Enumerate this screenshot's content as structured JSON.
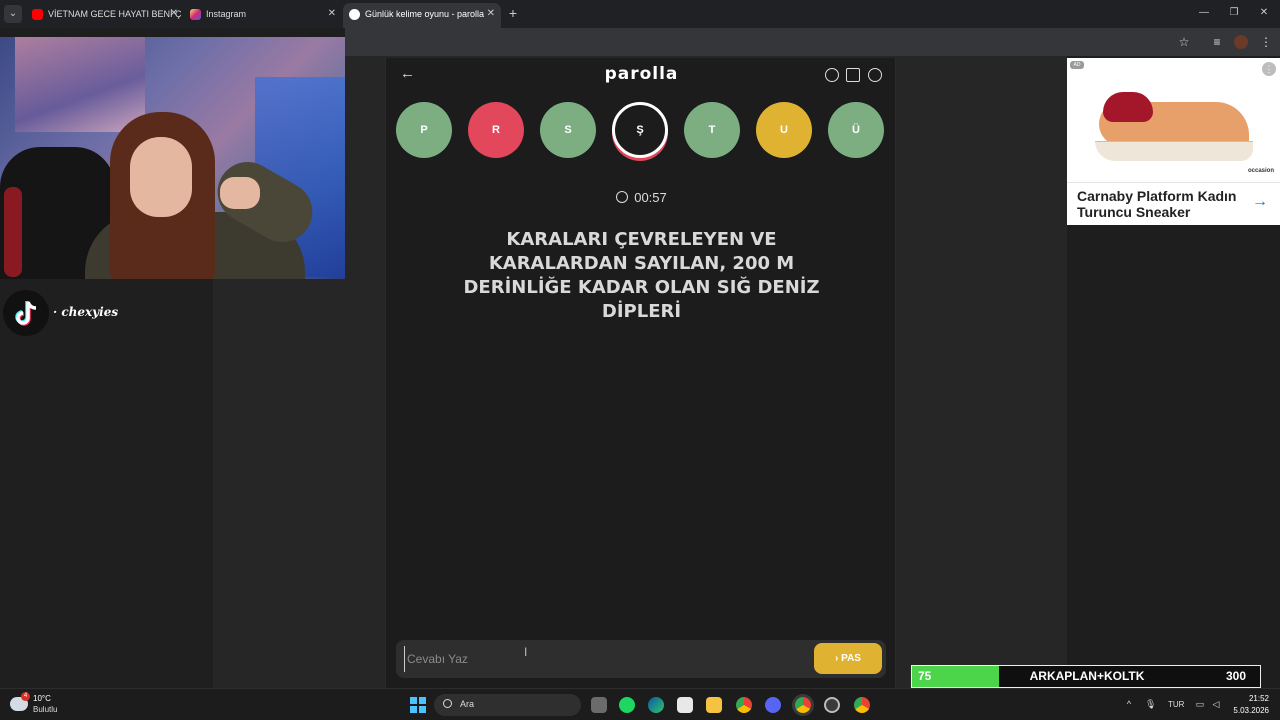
{
  "browser": {
    "tabs": [
      {
        "title": "VİETNAM GECE HAYATI BENİ Ç",
        "favicon_color": "#ff0000",
        "active": false
      },
      {
        "title": "Instagram",
        "favicon_color": "#d62976",
        "active": false
      },
      {
        "title": "Günlük kelime oyunu - parolla",
        "favicon_color": "#ffffff",
        "active": true
      }
    ]
  },
  "stream": {
    "username": "· chexyies"
  },
  "game": {
    "logo": "parolla",
    "letters": [
      {
        "letter": "P",
        "color": "#7dae82",
        "state": "correct"
      },
      {
        "letter": "R",
        "color": "#e2475b",
        "state": "wrong"
      },
      {
        "letter": "S",
        "color": "#7dae82",
        "state": "correct"
      },
      {
        "letter": "Ş",
        "color": "#1c1c1c",
        "state": "current"
      },
      {
        "letter": "T",
        "color": "#7dae82",
        "state": "correct"
      },
      {
        "letter": "U",
        "color": "#e0b232",
        "state": "passed"
      },
      {
        "letter": "Ü",
        "color": "#7dae82",
        "state": "correct"
      }
    ],
    "timer": "00:57",
    "question": "KARALARI ÇEVRELEYEN VE KARALARDAN SAYILAN, 200 M DERİNLİĞE KADAR OLAN SIĞ DENİZ DİPLERİ",
    "answer_placeholder": "Cevabı Yaz",
    "answer_value": "",
    "pass_label": "PAS",
    "pass_icon": "chevron-right-icon"
  },
  "ad": {
    "badge": "AD",
    "brand": "occasion",
    "title": "Carnaby Platform Kadın Turuncu Sneaker"
  },
  "goal_bar": {
    "current": "75",
    "label": "ARKAPLAN+KOLTK",
    "target": "300",
    "fill_fraction": 0.25,
    "fill_color": "#4cd44a"
  },
  "taskbar": {
    "weather_badge": "4",
    "weather_temp": "10°C",
    "weather_desc": "Bulutlu",
    "search_placeholder": "Ara",
    "language": "TUR",
    "time": "21:52",
    "date": "5.03.2026"
  }
}
